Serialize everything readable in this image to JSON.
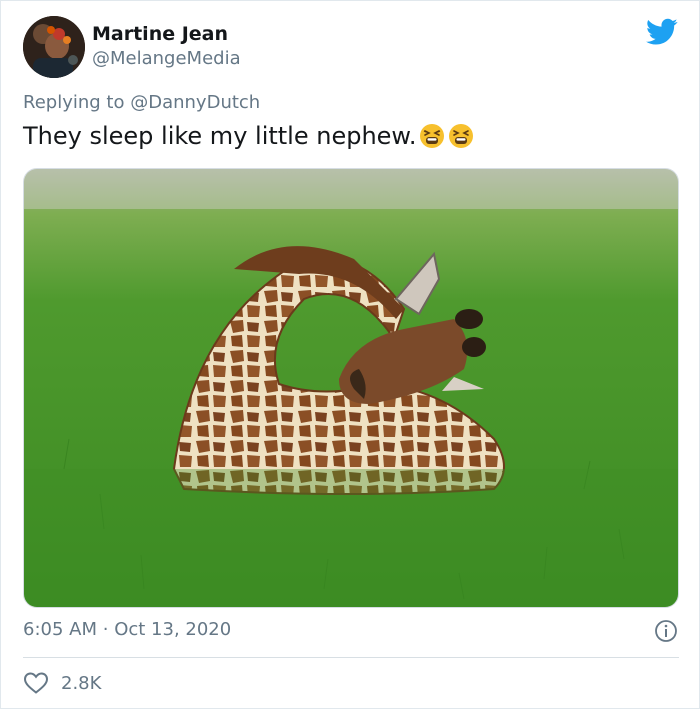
{
  "tweet": {
    "author_name": "Martine Jean",
    "author_handle": "@MelangeMedia",
    "reply_prefix": "Replying to",
    "reply_handle": "@DannyDutch",
    "text": "They sleep like my little nephew.",
    "emojis": [
      "tired-face-emoji",
      "tired-face-emoji"
    ],
    "time": "6:05 AM",
    "separator": "·",
    "date": "Oct 13, 2020",
    "like_count": "2.8K"
  },
  "colors": {
    "twitter_blue": "#1da1f2",
    "secondary_text": "#657786",
    "primary_text": "#14171a"
  }
}
